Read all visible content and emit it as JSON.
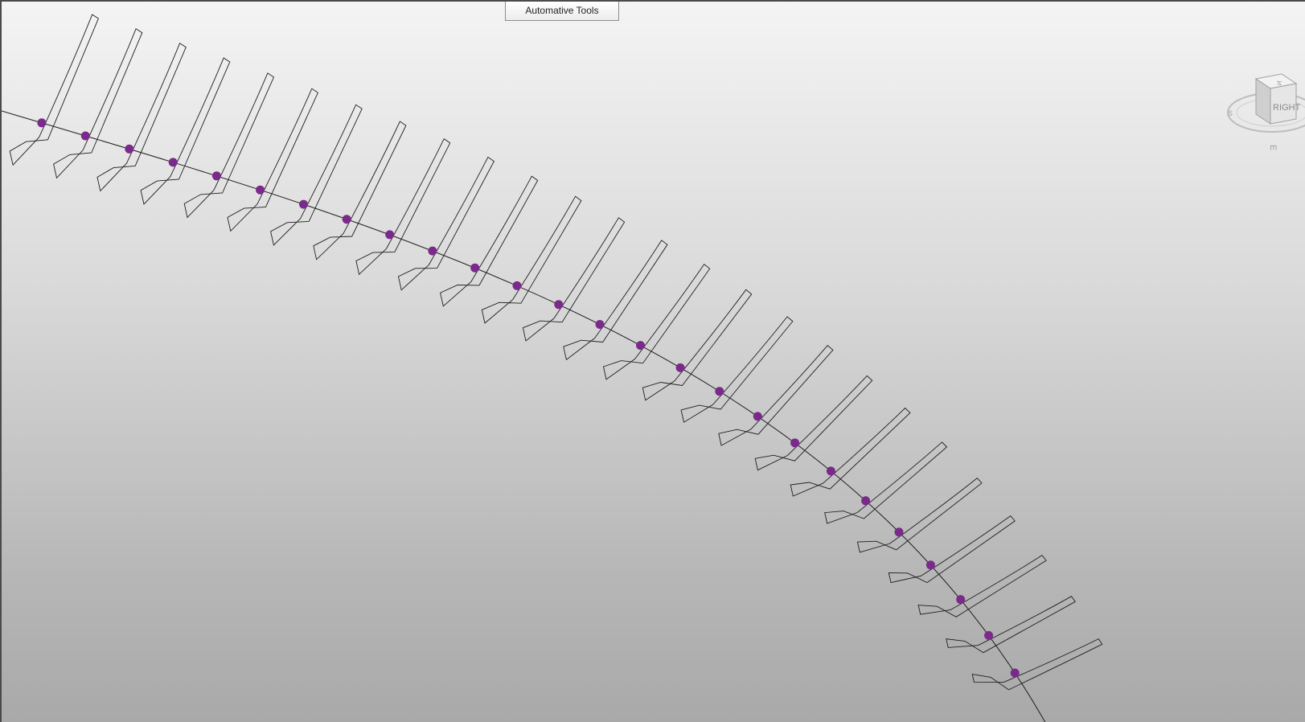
{
  "toolbar": {
    "tab_label": "Automative Tools"
  },
  "viewcube": {
    "face_label": "RIGHT",
    "top_face_label": "И",
    "compass_letters": [
      "S",
      "E"
    ],
    "icon": "viewcube-icon"
  },
  "colors": {
    "point_color": "#7a2a8a",
    "line_color": "#1e1e1e",
    "background_top": "#f4f4f4",
    "background_bottom": "#a9a9a9"
  },
  "scene": {
    "point_count": 26,
    "icon": "spline-with-rib-profiles"
  }
}
